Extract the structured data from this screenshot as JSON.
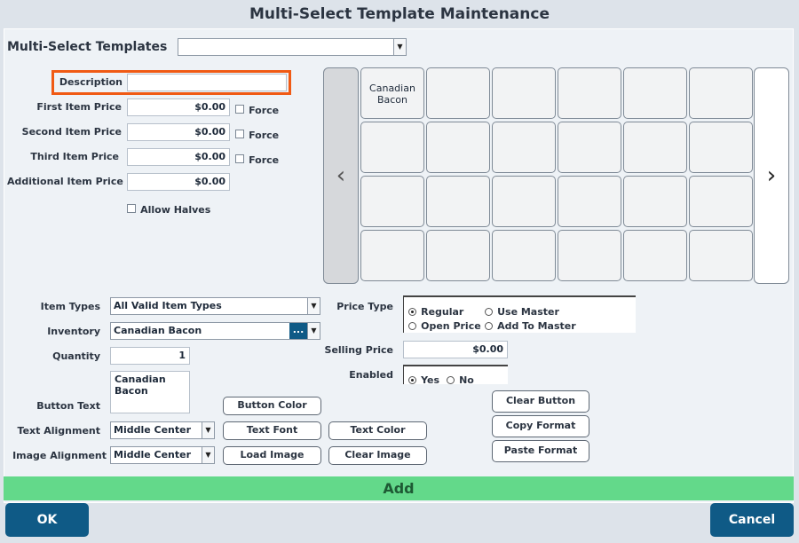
{
  "window_title": "Multi-Select Template Maintenance",
  "templates_label": "Multi-Select Templates",
  "templates_selected": "",
  "form": {
    "description_label": "Description",
    "description_value": "",
    "first_price_label": "First Item Price",
    "first_price_value": "$0.00",
    "second_price_label": "Second Item Price",
    "second_price_value": "$0.00",
    "third_price_label": "Third Item Price",
    "third_price_value": "$0.00",
    "additional_price_label": "Additional Item Price",
    "additional_price_value": "$0.00",
    "force_label": "Force",
    "allow_halves_label": "Allow Halves"
  },
  "grid": {
    "buttons": [
      "Canadian Bacon",
      "",
      "",
      "",
      "",
      "",
      "",
      "",
      "",
      "",
      "",
      "",
      "",
      "",
      "",
      "",
      "",
      "",
      "",
      "",
      "",
      "",
      "",
      ""
    ]
  },
  "nav": {
    "prev": "‹",
    "next": "›"
  },
  "details": {
    "item_types_label": "Item Types",
    "item_types_value": "All Valid Item Types",
    "inventory_label": "Inventory",
    "inventory_value": "Canadian Bacon",
    "inventory_browse": "...",
    "quantity_label": "Quantity",
    "quantity_value": "1",
    "button_text_label": "Button Text",
    "button_text_value": "Canadian\nBacon",
    "text_alignment_label": "Text Alignment",
    "text_alignment_value": "Middle Center",
    "image_alignment_label": "Image Alignment",
    "image_alignment_value": "Middle Center",
    "price_type_label": "Price Type",
    "price_type_options": [
      "Regular",
      "Use Master",
      "Open Price",
      "Add To Master"
    ],
    "price_type_selected": "Regular",
    "selling_price_label": "Selling Price",
    "selling_price_value": "$0.00",
    "enabled_label": "Enabled",
    "enabled_yes": "Yes",
    "enabled_no": "No",
    "enabled_selected": "Yes"
  },
  "buttons": {
    "button_color": "Button Color",
    "text_font": "Text Font",
    "text_color": "Text Color",
    "load_image": "Load Image",
    "clear_image": "Clear Image",
    "clear_button": "Clear Button",
    "copy_format": "Copy Format",
    "paste_format": "Paste Format",
    "add": "Add",
    "ok": "OK",
    "cancel": "Cancel"
  },
  "colors": {
    "highlight": "#f05a14",
    "add_bar": "#63d98a",
    "primary_button": "#0f5a86"
  },
  "icons": {
    "prev": "chevron-left-icon",
    "next": "chevron-right-icon",
    "dropdown": "dropdown-arrow-icon"
  }
}
